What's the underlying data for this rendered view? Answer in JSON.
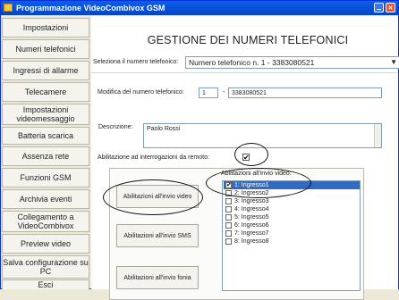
{
  "window": {
    "title": "Programmazione VideoCombivox GSM"
  },
  "sidebar": {
    "items": [
      {
        "label": "Impostazioni"
      },
      {
        "label": "Numeri telefonici"
      },
      {
        "label": "Ingressi di allarme"
      },
      {
        "label": "Telecamere"
      },
      {
        "label": "Impostazioni videomessaggio"
      },
      {
        "label": "Batteria scarica"
      },
      {
        "label": "Assenza rete"
      },
      {
        "label": "Funzioni GSM"
      },
      {
        "label": "Archivia eventi"
      },
      {
        "label": "Collegamento a VideoCombivox"
      },
      {
        "label": "Preview video"
      },
      {
        "label": "Salva configurazione su PC"
      },
      {
        "label": "Esci"
      }
    ]
  },
  "main": {
    "heading": "GESTIONE DEI NUMERI TELEFONICI",
    "select_label": "Seleziona il numero telefonico:",
    "select_value": "Numero telefonico n. 1 - 3383080521",
    "modify_label": "Modifica del numero telefonico:",
    "number_index": "1",
    "number_dash": "-",
    "number_value": "3383080521",
    "description_label": "Descrizione:",
    "description_value": "Paolo Rossi",
    "remote_label": "Abilitazione ad interrogazioni da remoto:",
    "remote_checked": "✔",
    "btn_video": "Abilitazioni all'invio video",
    "btn_sms": "Abilitazioni all'invio SMS",
    "btn_voice": "Abilitazioni all'invio fonia",
    "list_header": "Abilitazioni all'invio video:",
    "list_items": [
      {
        "label": "1: Ingresso1",
        "checked": "✔"
      },
      {
        "label": "2: Ingresso2",
        "checked": ""
      },
      {
        "label": "3: Ingresso3",
        "checked": ""
      },
      {
        "label": "4: Ingresso4",
        "checked": ""
      },
      {
        "label": "5: Ingresso5",
        "checked": ""
      },
      {
        "label": "6: Ingresso6",
        "checked": ""
      },
      {
        "label": "7: Ingresso7",
        "checked": ""
      },
      {
        "label": "8: Ingresso8",
        "checked": ""
      }
    ]
  }
}
